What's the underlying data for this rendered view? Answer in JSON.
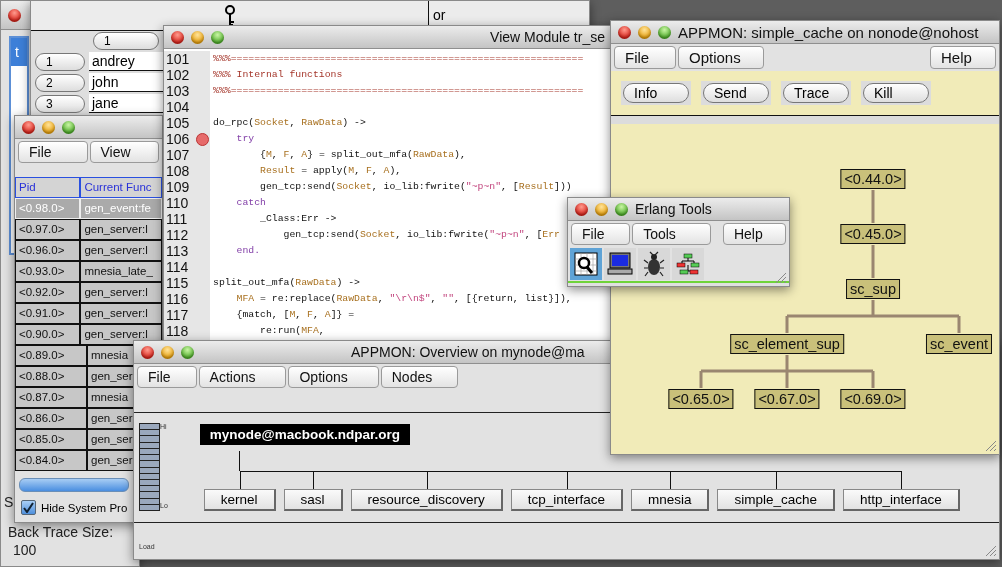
{
  "left_window": {
    "list_item": {
      "label": "t",
      "selected": true
    },
    "label": "S",
    "back_trace": {
      "label": "Back Trace Size:",
      "value": "100"
    }
  },
  "table_window": {
    "column_2": "or",
    "row_header": "1",
    "rows": [
      {
        "number": "1",
        "name": "andrey"
      },
      {
        "number": "2",
        "name": "john"
      },
      {
        "number": "3",
        "name": "jane"
      }
    ]
  },
  "process_window": {
    "menu": [
      "File",
      "View"
    ],
    "columns": [
      "Pid",
      "Current Func"
    ],
    "rows": [
      {
        "pid": "<0.98.0>",
        "function": "gen_event:fe",
        "selected": true
      },
      {
        "pid": "<0.97.0>",
        "function": "gen_server:l",
        "selected": false
      },
      {
        "pid": "<0.96.0>",
        "function": "gen_server:l",
        "selected": false
      },
      {
        "pid": "<0.93.0>",
        "function": "mnesia_late_",
        "selected": false
      },
      {
        "pid": "<0.92.0>",
        "function": "gen_server:l",
        "selected": false
      },
      {
        "pid": "<0.91.0>",
        "function": "gen_server:l",
        "selected": false
      },
      {
        "pid": "<0.90.0>",
        "function": "gen_server:l",
        "selected": false
      },
      {
        "pid": "<0.89.0>",
        "function": "mnesia",
        "selected": false
      },
      {
        "pid": "<0.88.0>",
        "function": "gen_ser",
        "selected": false
      },
      {
        "pid": "<0.87.0>",
        "function": "mnesia",
        "selected": false
      },
      {
        "pid": "<0.86.0>",
        "function": "gen_ser",
        "selected": false
      },
      {
        "pid": "<0.85.0>",
        "function": "gen_ser",
        "selected": false
      },
      {
        "pid": "<0.84.0>",
        "function": "gen_ser",
        "selected": false
      }
    ],
    "hide_system": {
      "label": "Hide System Pro",
      "checked": true
    }
  },
  "module_window": {
    "title": "View Module tr_se",
    "lines": [
      {
        "number": "101",
        "breakpoint": false,
        "tokens": [
          {
            "kind": "comment",
            "text": "%%%============================================================"
          }
        ]
      },
      {
        "number": "102",
        "breakpoint": false,
        "tokens": [
          {
            "kind": "comment",
            "text": "%%% Internal functions"
          }
        ]
      },
      {
        "number": "103",
        "breakpoint": false,
        "tokens": [
          {
            "kind": "comment",
            "text": "%%%============================================================"
          }
        ]
      },
      {
        "number": "104",
        "breakpoint": false
      },
      {
        "number": "105",
        "breakpoint": false,
        "tokens": [
          {
            "kind": "plain",
            "text": "do_rpc("
          },
          {
            "kind": "var",
            "text": "Socket"
          },
          {
            "kind": "plain",
            "text": ", "
          },
          {
            "kind": "var",
            "text": "RawData"
          },
          {
            "kind": "plain",
            "text": ") ->"
          }
        ]
      },
      {
        "number": "106",
        "breakpoint": true,
        "tokens": [
          {
            "kind": "keyword",
            "text": "    try"
          }
        ]
      },
      {
        "number": "107",
        "breakpoint": false,
        "tokens": [
          {
            "kind": "plain",
            "text": "        {"
          },
          {
            "kind": "var",
            "text": "M"
          },
          {
            "kind": "plain",
            "text": ", "
          },
          {
            "kind": "var",
            "text": "F"
          },
          {
            "kind": "plain",
            "text": ", "
          },
          {
            "kind": "var",
            "text": "A"
          },
          {
            "kind": "plain",
            "text": "} = split_out_mfa("
          },
          {
            "kind": "var",
            "text": "RawData"
          },
          {
            "kind": "plain",
            "text": "),"
          }
        ]
      },
      {
        "number": "108",
        "breakpoint": false,
        "tokens": [
          {
            "kind": "var",
            "text": "        Result"
          },
          {
            "kind": "plain",
            "text": " = apply("
          },
          {
            "kind": "var",
            "text": "M"
          },
          {
            "kind": "plain",
            "text": ", "
          },
          {
            "kind": "var",
            "text": "F"
          },
          {
            "kind": "plain",
            "text": ", "
          },
          {
            "kind": "var",
            "text": "A"
          },
          {
            "kind": "plain",
            "text": "),"
          }
        ]
      },
      {
        "number": "109",
        "breakpoint": false,
        "tokens": [
          {
            "kind": "plain",
            "text": "        gen_tcp:send("
          },
          {
            "kind": "var",
            "text": "Socket"
          },
          {
            "kind": "plain",
            "text": ", io_lib:fwrite("
          },
          {
            "kind": "string",
            "text": "\"~p~n\""
          },
          {
            "kind": "plain",
            "text": ", ["
          },
          {
            "kind": "var",
            "text": "Result"
          },
          {
            "kind": "plain",
            "text": "]))"
          }
        ]
      },
      {
        "number": "110",
        "breakpoint": false,
        "tokens": [
          {
            "kind": "keyword",
            "text": "    catch"
          }
        ]
      },
      {
        "number": "111",
        "breakpoint": false,
        "tokens": [
          {
            "kind": "plain",
            "text": "        _Class:Err ->"
          }
        ]
      },
      {
        "number": "112",
        "breakpoint": false,
        "tokens": [
          {
            "kind": "plain",
            "text": "            gen_tcp:send("
          },
          {
            "kind": "var",
            "text": "Socket"
          },
          {
            "kind": "plain",
            "text": ", io_lib:fwrite("
          },
          {
            "kind": "string",
            "text": "\"~p~n\""
          },
          {
            "kind": "plain",
            "text": ", ["
          },
          {
            "kind": "var",
            "text": "Err"
          }
        ]
      },
      {
        "number": "113",
        "breakpoint": false,
        "tokens": [
          {
            "kind": "keyword",
            "text": "    end."
          }
        ]
      },
      {
        "number": "114",
        "breakpoint": false
      },
      {
        "number": "115",
        "breakpoint": false,
        "tokens": [
          {
            "kind": "plain",
            "text": "split_out_mfa("
          },
          {
            "kind": "var",
            "text": "RawData"
          },
          {
            "kind": "plain",
            "text": ") ->"
          }
        ]
      },
      {
        "number": "116",
        "breakpoint": false,
        "tokens": [
          {
            "kind": "var",
            "text": "    MFA"
          },
          {
            "kind": "plain",
            "text": " = re:replace("
          },
          {
            "kind": "var",
            "text": "RawData"
          },
          {
            "kind": "plain",
            "text": ", "
          },
          {
            "kind": "string",
            "text": "\"\\r\\n$\""
          },
          {
            "kind": "plain",
            "text": ", "
          },
          {
            "kind": "string",
            "text": "\"\""
          },
          {
            "kind": "plain",
            "text": ", [{return, list}]),"
          }
        ]
      },
      {
        "number": "117",
        "breakpoint": false,
        "tokens": [
          {
            "kind": "plain",
            "text": "    {match, ["
          },
          {
            "kind": "var",
            "text": "M"
          },
          {
            "kind": "plain",
            "text": ", "
          },
          {
            "kind": "var",
            "text": "F"
          },
          {
            "kind": "plain",
            "text": ", "
          },
          {
            "kind": "var",
            "text": "A"
          },
          {
            "kind": "plain",
            "text": "]} ="
          }
        ]
      },
      {
        "number": "118",
        "breakpoint": false,
        "tokens": [
          {
            "kind": "plain",
            "text": "        re:run("
          },
          {
            "kind": "var",
            "text": "MFA"
          },
          {
            "kind": "plain",
            "text": ","
          }
        ]
      }
    ]
  },
  "overview_window": {
    "title": "APPMON: Overview on mynode@ma",
    "menu": [
      "File",
      "Actions",
      "Options",
      "Nodes"
    ],
    "load_meter": {
      "high": "Hi",
      "low": "Lo",
      "label": "Load"
    },
    "node": "mynode@macbook.ndpar.org",
    "applications": [
      "kernel",
      "sasl",
      "resource_discovery",
      "tcp_interface",
      "mnesia",
      "simple_cache",
      "http_interface"
    ]
  },
  "app_window": {
    "title": "APPMON: simple_cache on nonode@nohost",
    "menu": [
      "File",
      "Options"
    ],
    "help_menu": "Help",
    "actions": [
      "Info",
      "Send",
      "Trace",
      "Kill"
    ],
    "process_tree": {
      "label": "<0.44.0>",
      "children": [
        {
          "label": "<0.45.0>",
          "children": [
            {
              "label": "sc_sup",
              "children": [
                {
                  "label": "sc_element_sup",
                  "children": [
                    {
                      "label": "<0.65.0>"
                    },
                    {
                      "label": "<0.67.0>"
                    },
                    {
                      "label": "<0.69.0>"
                    }
                  ]
                },
                {
                  "label": "sc_event"
                }
              ]
            }
          ]
        }
      ]
    }
  },
  "tools_window": {
    "title": "Erlang Tools",
    "menu": [
      "File",
      "Tools",
      "Help"
    ],
    "tools": [
      {
        "kind": "table",
        "selected": true
      },
      {
        "kind": "monitor",
        "selected": false
      },
      {
        "kind": "bug",
        "selected": false
      },
      {
        "kind": "tree",
        "selected": false
      }
    ]
  }
}
